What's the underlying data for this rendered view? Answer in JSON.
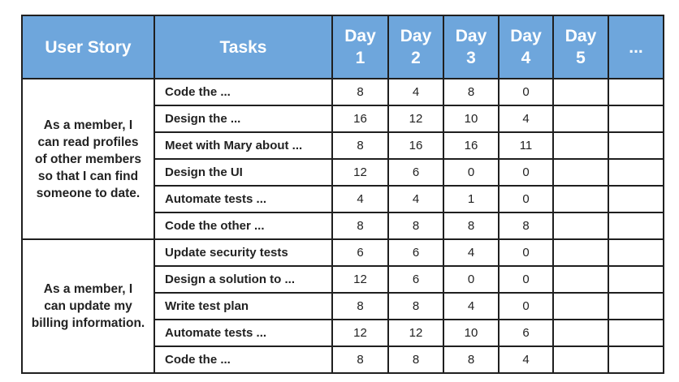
{
  "headers": {
    "user_story": "User Story",
    "tasks": "Tasks",
    "day1": "Day\n1",
    "day2": "Day\n2",
    "day3": "Day\n3",
    "day4": "Day\n4",
    "day5": "Day\n5",
    "more": "..."
  },
  "stories": [
    {
      "text": "As a member, I\ncan read profiles\nof other members\nso that I can find\nsomeone to date.",
      "tasks": [
        {
          "name": "Code the ...",
          "days": [
            "8",
            "4",
            "8",
            "0"
          ]
        },
        {
          "name": "Design the ...",
          "days": [
            "16",
            "12",
            "10",
            "4"
          ]
        },
        {
          "name": "Meet with Mary about ...",
          "days": [
            "8",
            "16",
            "16",
            "11"
          ]
        },
        {
          "name": "Design the UI",
          "days": [
            "12",
            "6",
            "0",
            "0"
          ]
        },
        {
          "name": "Automate tests ...",
          "days": [
            "4",
            "4",
            "1",
            "0"
          ]
        },
        {
          "name": "Code the other ...",
          "days": [
            "8",
            "8",
            "8",
            "8"
          ]
        }
      ]
    },
    {
      "text": "As a member, I\ncan update my\nbilling information.",
      "tasks": [
        {
          "name": "Update security tests",
          "days": [
            "6",
            "6",
            "4",
            "0"
          ]
        },
        {
          "name": "Design a solution to ...",
          "days": [
            "12",
            "6",
            "0",
            "0"
          ]
        },
        {
          "name": "Write test plan",
          "days": [
            "8",
            "8",
            "4",
            "0"
          ]
        },
        {
          "name": "Automate tests ...",
          "days": [
            "12",
            "12",
            "10",
            "6"
          ]
        },
        {
          "name": "Code the ...",
          "days": [
            "8",
            "8",
            "8",
            "4"
          ]
        }
      ]
    }
  ]
}
